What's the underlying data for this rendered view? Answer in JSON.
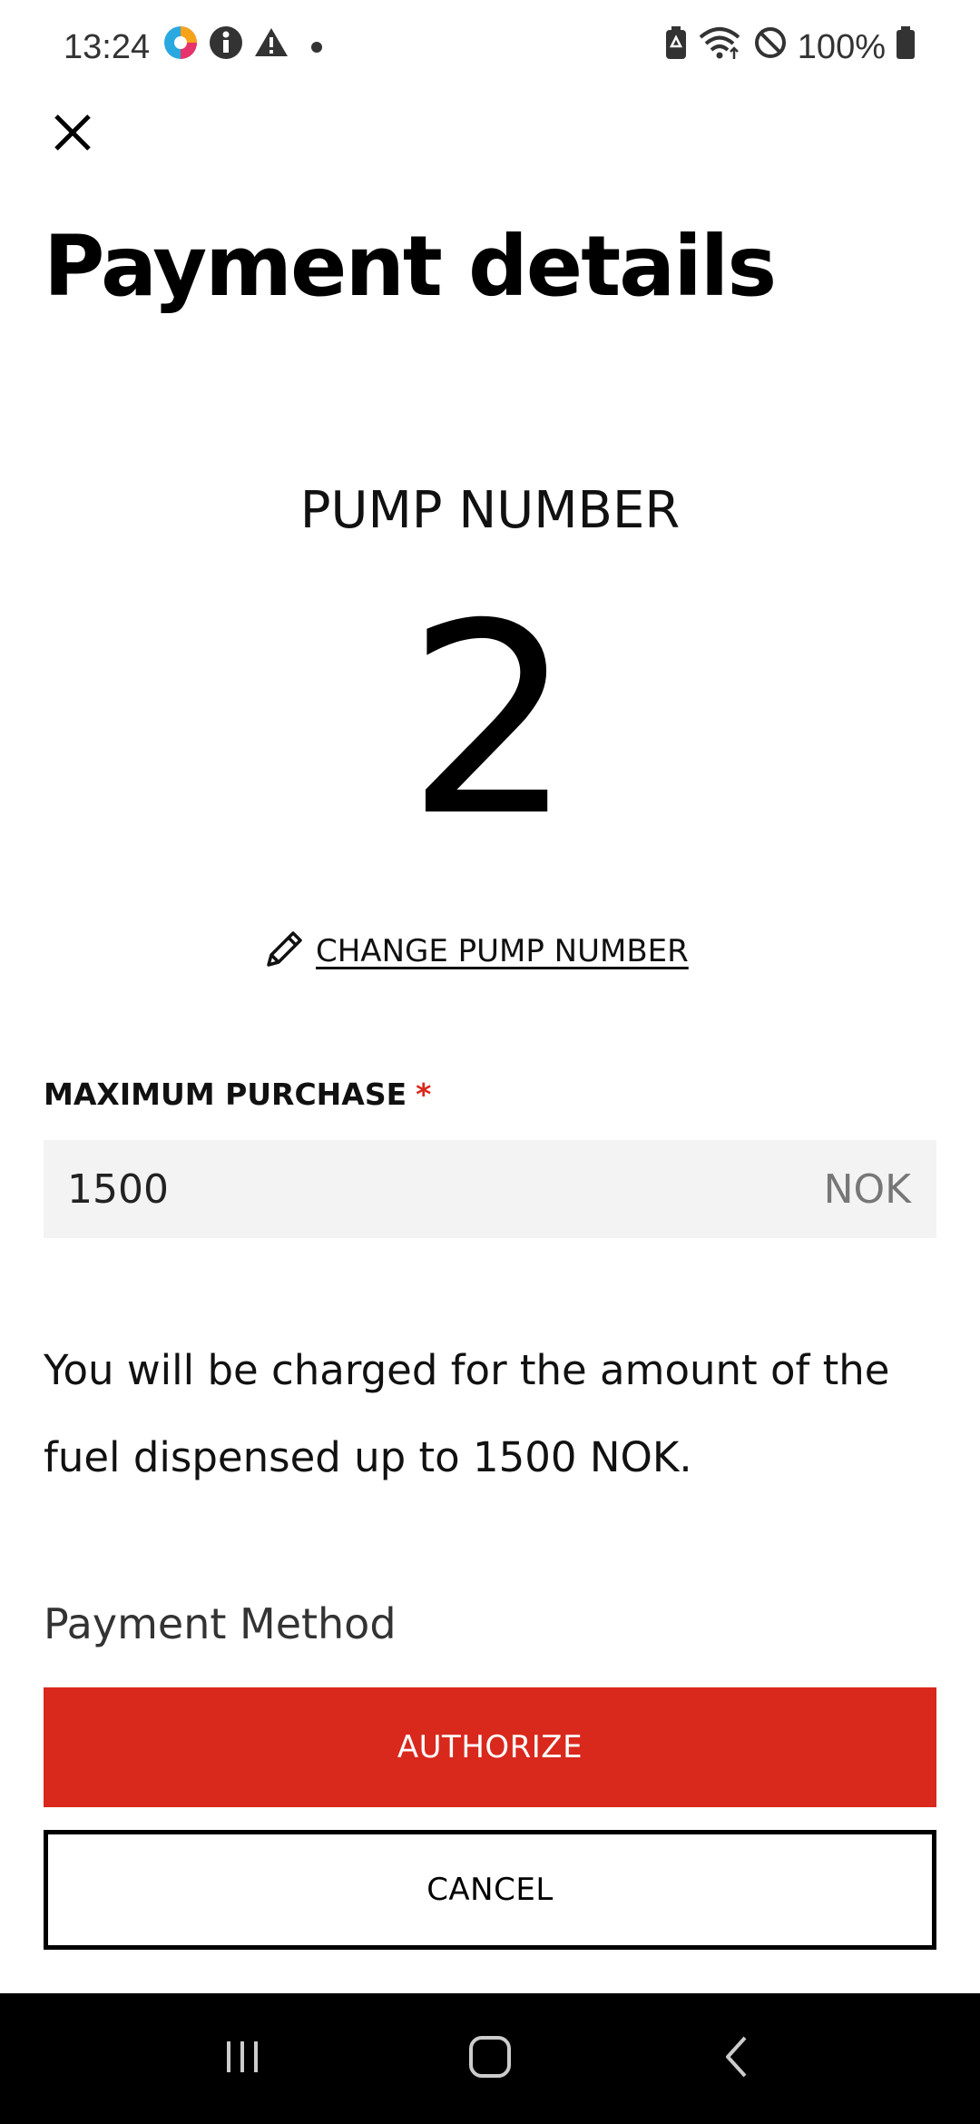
{
  "status_bar": {
    "time": "13:24",
    "battery": "100%",
    "icons": [
      "app-logo-icon",
      "info-icon",
      "warning-icon",
      "battery-saver-icon",
      "wifi-icon",
      "do-not-disturb-icon",
      "battery-icon"
    ]
  },
  "header": {
    "close_icon": "close-icon",
    "title": "Payment details"
  },
  "pump": {
    "label": "PUMP NUMBER",
    "number": "2",
    "change_label": "CHANGE PUMP NUMBER",
    "change_icon": "pencil-icon"
  },
  "max_purchase": {
    "label": "MAXIMUM PURCHASE",
    "required_mark": "*",
    "value": "1500",
    "unit": "NOK"
  },
  "info": {
    "text": "You will be charged for the amount of the fuel dispensed up to 1500 NOK."
  },
  "payment_method": {
    "label": "Payment Method"
  },
  "actions": {
    "authorize_label": "AUTHORIZE",
    "cancel_label": "CANCEL"
  },
  "nav_bar": {
    "icons": [
      "recent-apps-icon",
      "home-icon",
      "back-icon"
    ]
  },
  "colors": {
    "accent": "#d9281c",
    "field_bg": "#f3f3f3",
    "nav_bg": "#000000"
  }
}
